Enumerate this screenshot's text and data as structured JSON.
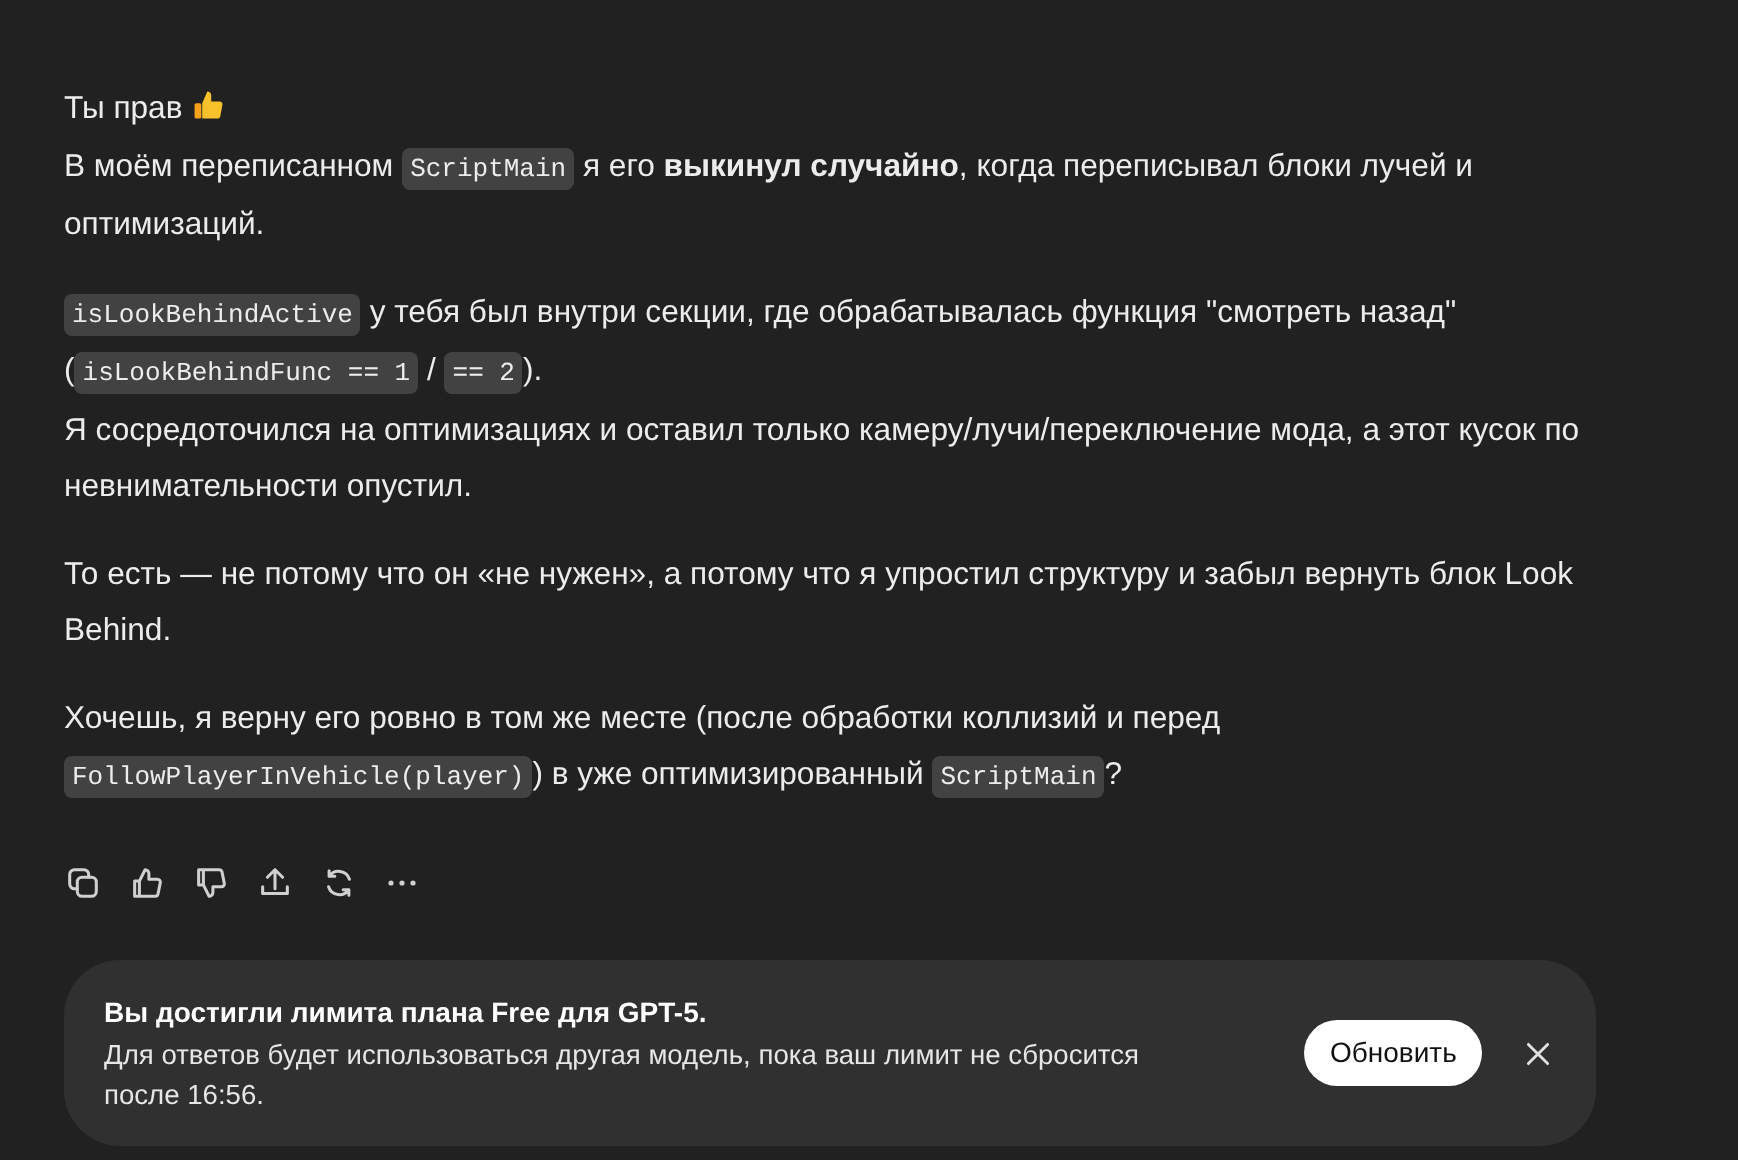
{
  "message": {
    "paragraphs": [
      {
        "lines": [
          [
            {
              "kind": "text",
              "text": "Ты прав "
            },
            {
              "kind": "emoji"
            }
          ],
          [
            {
              "kind": "text",
              "text": "В моём переписанном "
            },
            {
              "kind": "code",
              "text": "ScriptMain"
            },
            {
              "kind": "text",
              "text": " я его **выкинул случайно**, когда переписывал блоки лучей и"
            }
          ],
          [
            {
              "kind": "text",
              "text": "оптимизаций."
            }
          ]
        ]
      },
      {
        "lines": [
          [
            {
              "kind": "code",
              "text": "isLookBehindActive"
            },
            {
              "kind": "text",
              "text": " у тебя был внутри секции, где обрабатывалась функция \"смотреть назад\""
            }
          ],
          [
            {
              "kind": "text",
              "text": "("
            },
            {
              "kind": "code",
              "text": "isLookBehindFunc == 1"
            },
            {
              "kind": "text",
              "text": " / "
            },
            {
              "kind": "code",
              "text": "== 2"
            },
            {
              "kind": "text",
              "text": ")."
            }
          ],
          [
            {
              "kind": "text",
              "text": "Я сосредоточился на оптимизациях и оставил только камеру/лучи/переключение мода, а этот кусок по"
            }
          ],
          [
            {
              "kind": "text",
              "text": "невнимательности опустил."
            }
          ]
        ]
      },
      {
        "lines": [
          [
            {
              "kind": "text",
              "text": "То есть — не потому что он «не нужен», а потому что я упростил структуру и забыл вернуть блок Look"
            }
          ],
          [
            {
              "kind": "text",
              "text": "Behind."
            }
          ]
        ]
      },
      {
        "lines": [
          [
            {
              "kind": "text",
              "text": "Хочешь, я верну его ровно в том же месте (после обработки коллизий и перед"
            }
          ],
          [
            {
              "kind": "code",
              "text": "FollowPlayerInVehicle(player)"
            },
            {
              "kind": "text",
              "text": ") в уже оптимизированный "
            },
            {
              "kind": "code",
              "text": "ScriptMain"
            },
            {
              "kind": "text",
              "text": "?"
            }
          ]
        ]
      }
    ]
  },
  "actions": [
    {
      "kind": "copy"
    },
    {
      "kind": "like"
    },
    {
      "kind": "dislike"
    },
    {
      "kind": "share"
    },
    {
      "kind": "regenerate"
    },
    {
      "kind": "more"
    }
  ],
  "banner": {
    "title": "Вы достигли лимита плана Free для GPT-5.",
    "body": "Для ответов будет использоваться другая модель, пока ваш лимит не сбросится после 16:56.",
    "button": "Обновить"
  }
}
